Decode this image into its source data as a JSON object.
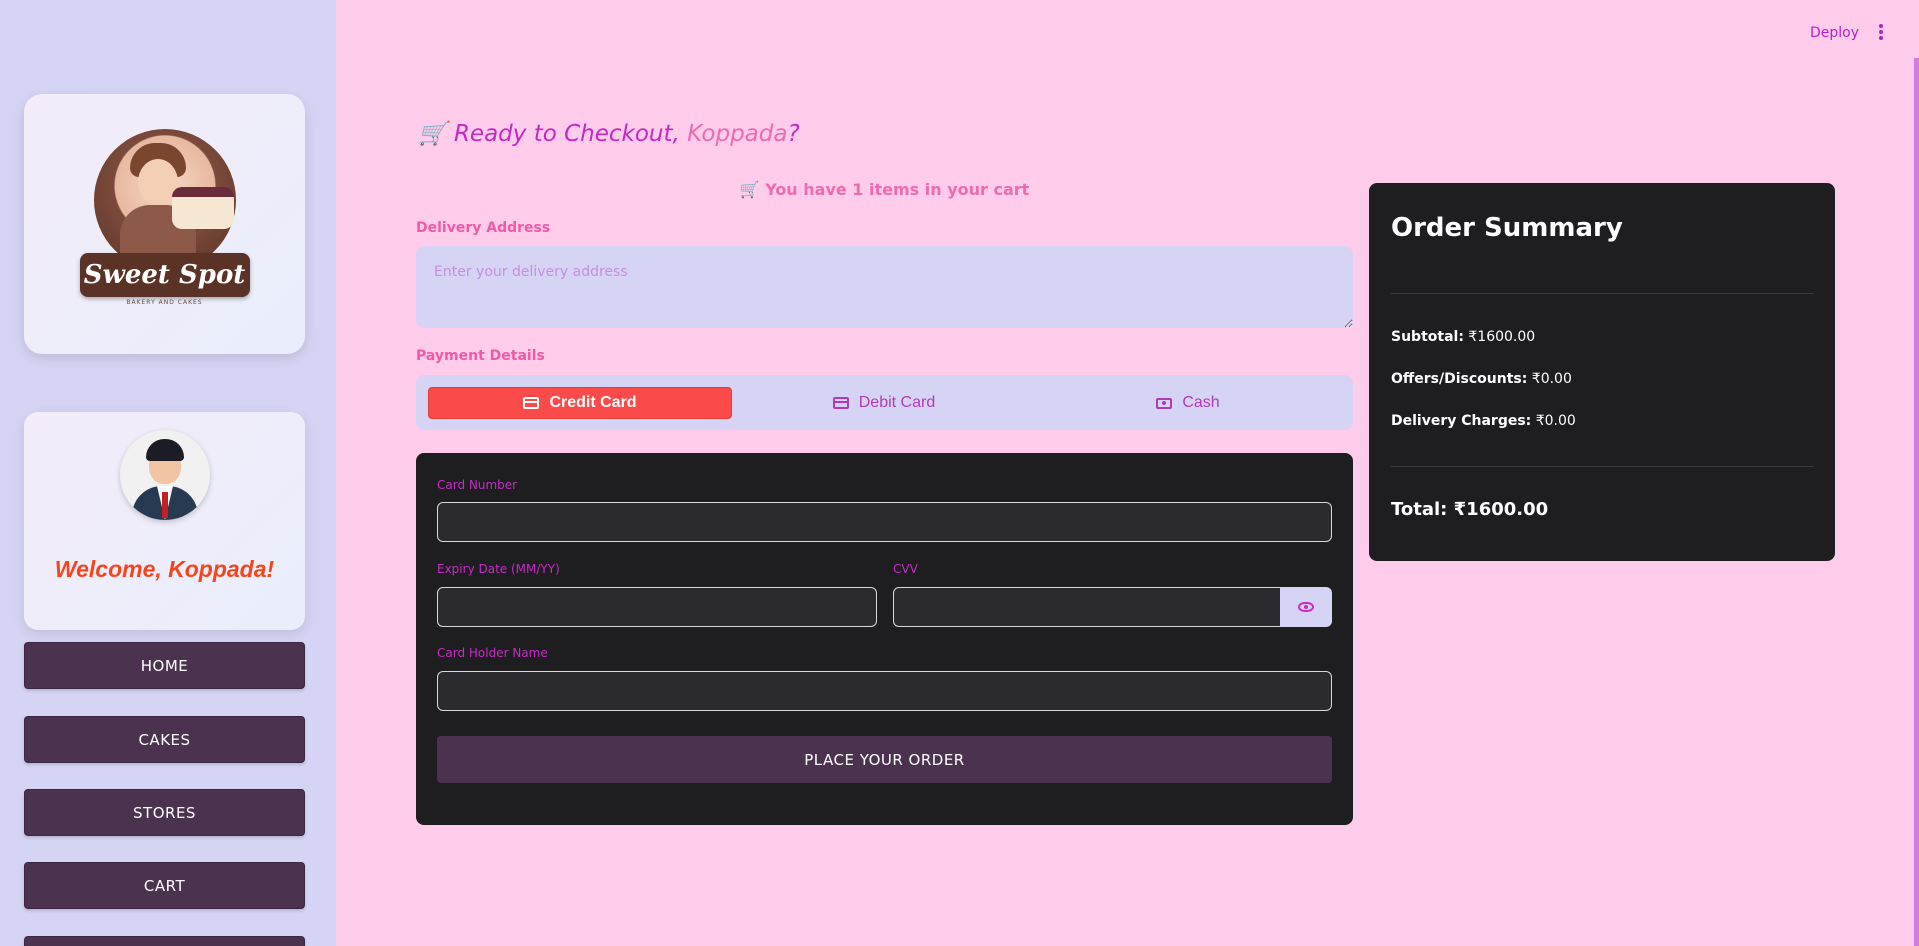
{
  "header": {
    "deploy_label": "Deploy"
  },
  "sidebar": {
    "logo_text": "Sweet Spot",
    "logo_subtext": "BAKERY AND CAKES",
    "welcome": "Welcome, Koppada!",
    "nav": [
      {
        "label": "HOME"
      },
      {
        "label": "CAKES"
      },
      {
        "label": "STORES"
      },
      {
        "label": "CART"
      }
    ]
  },
  "main": {
    "title_prefix": "🛒 Ready to Checkout, ",
    "title_name": "Koppada",
    "title_suffix": "?",
    "cart_count": "🛒 You have 1 items in your cart",
    "delivery_label": "Delivery Address",
    "delivery_placeholder": "Enter your delivery address",
    "payment_label": "Payment Details",
    "payment_tabs": [
      {
        "label": "Credit Card",
        "icon": "credit-card-icon",
        "active": true
      },
      {
        "label": "Debit Card",
        "icon": "debit-card-icon",
        "active": false
      },
      {
        "label": "Cash",
        "icon": "cash-icon",
        "active": false
      }
    ],
    "card_form": {
      "card_number_label": "Card Number",
      "expiry_label": "Expiry Date (MM/YY)",
      "cvv_label": "CVV",
      "holder_label": "Card Holder Name",
      "submit_label": "PLACE YOUR ORDER"
    }
  },
  "summary": {
    "title": "Order Summary",
    "subtotal_label": "Subtotal:",
    "subtotal_value": "₹1600.00",
    "discount_label": "Offers/Discounts:",
    "discount_value": "₹0.00",
    "delivery_label": "Delivery Charges:",
    "delivery_value": "₹0.00",
    "total": "Total: ₹1600.00"
  },
  "colors": {
    "background": "#ffcceb",
    "sidebar": "#d6d4f4",
    "accent": "#c628c4",
    "pink": "#ef6ab0",
    "active_tab": "#fb4a4a",
    "button": "#4b3350",
    "panel": "#1e1d20"
  }
}
